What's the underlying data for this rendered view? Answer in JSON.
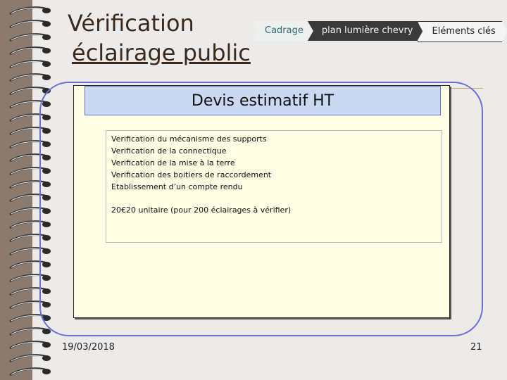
{
  "slide": {
    "title_line1": "Vérification",
    "title_line2": " éclairage public",
    "breadcrumbs": [
      "Cadrage",
      "plan lumière chevry",
      "Eléments clés"
    ],
    "section_title": "Devis estimatif HT",
    "items": [
      "Verification du mécanisme des supports",
      "Verification de la connectique",
      "Verification de la mise à la terre",
      "Verification des boitiers de raccordement",
      "Etablissement d’un compte rendu"
    ],
    "price_note": "20€20 unitaire (pour 200 éclairages à vérifier)",
    "date": "19/03/2018",
    "page_number": "21"
  },
  "colors": {
    "background": "#8b7b6e",
    "slide": "#ecebe9",
    "accent_teal": "#2f6b73",
    "frame_blue": "#6b6fd6",
    "header_band": "#c9d9f2",
    "panel": "#fffde3"
  }
}
